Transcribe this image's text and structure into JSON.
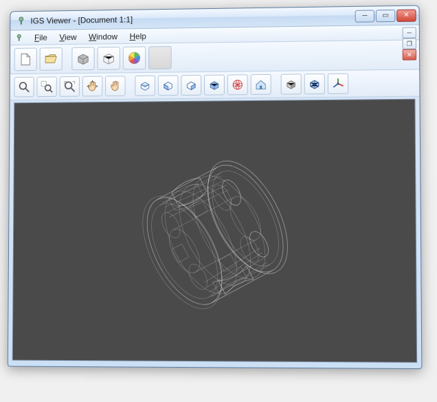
{
  "window": {
    "title": "IGS Viewer - [Document 1:1]"
  },
  "menu": {
    "file": "File",
    "view": "View",
    "window": "Window",
    "help": "Help"
  },
  "toolbar_row1": {
    "new": "new-document",
    "open": "open-folder",
    "shade_solid": "shade-solid",
    "shade_wire": "shade-wireframe",
    "color_wheel": "color-wheel",
    "empty": "empty-slot"
  },
  "toolbar_row2": {
    "zoom": "zoom",
    "zoom_area": "zoom-area",
    "zoom_fit": "zoom-fit",
    "pan": "pan",
    "rotate_hand": "rotate-hand",
    "view_top": "view-top",
    "view_front": "view-front",
    "view_side": "view-side",
    "view_iso": "view-iso",
    "orbit": "orbit-center",
    "home": "home",
    "render_solid_cube": "render-solid",
    "render_wire_cube": "render-wireframe",
    "axes": "axes-gizmo"
  },
  "winctrl": {
    "min": "minimize",
    "max": "maximize",
    "close": "close"
  }
}
